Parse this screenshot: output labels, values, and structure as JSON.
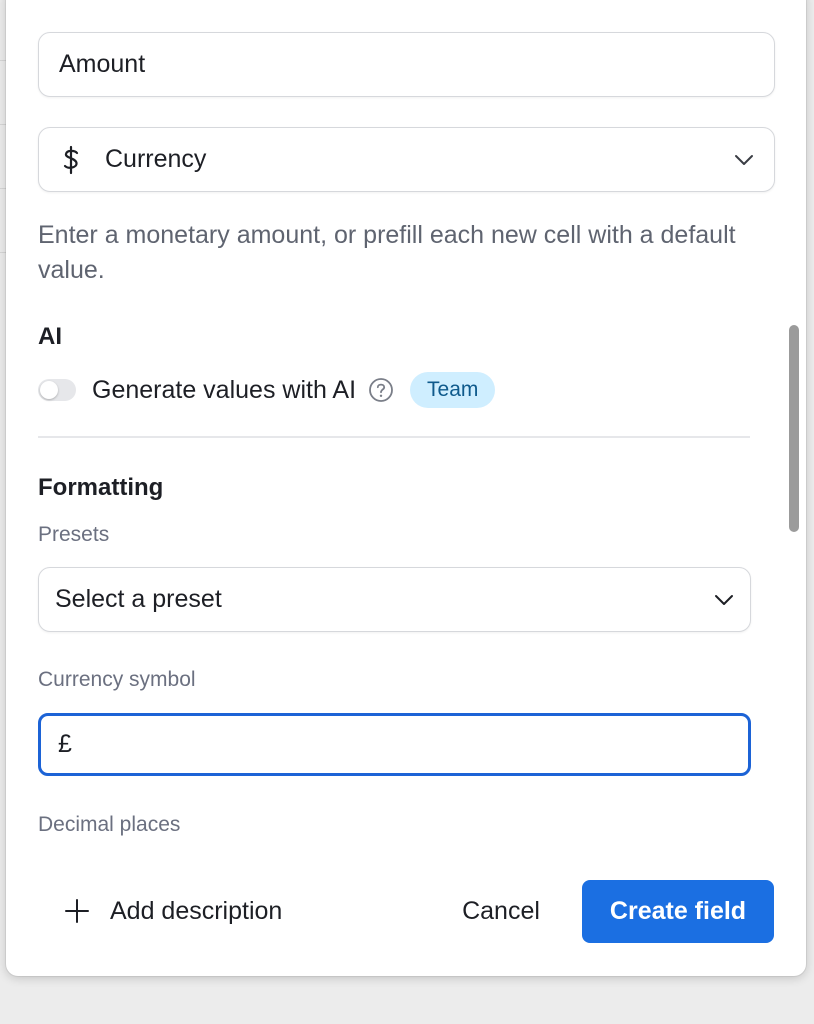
{
  "field": {
    "name_value": "Amount",
    "type_label": "Currency",
    "type_icon": "dollar-icon",
    "description": "Enter a monetary amount, or prefill each new cell with a default value."
  },
  "ai": {
    "section_title": "AI",
    "toggle_label": "Generate values with AI",
    "toggle_on": false,
    "badge": "Team"
  },
  "formatting": {
    "section_title": "Formatting",
    "presets_label": "Presets",
    "preset_placeholder": "Select a preset",
    "currency_symbol_label": "Currency symbol",
    "currency_symbol_value": "£",
    "decimal_places_label": "Decimal places"
  },
  "footer": {
    "add_description": "Add description",
    "cancel": "Cancel",
    "create": "Create field"
  },
  "colors": {
    "accent": "#1b6fe2",
    "focus_border": "#1c63d6",
    "badge_bg": "#cfeeff",
    "badge_text": "#0f5a8c"
  }
}
